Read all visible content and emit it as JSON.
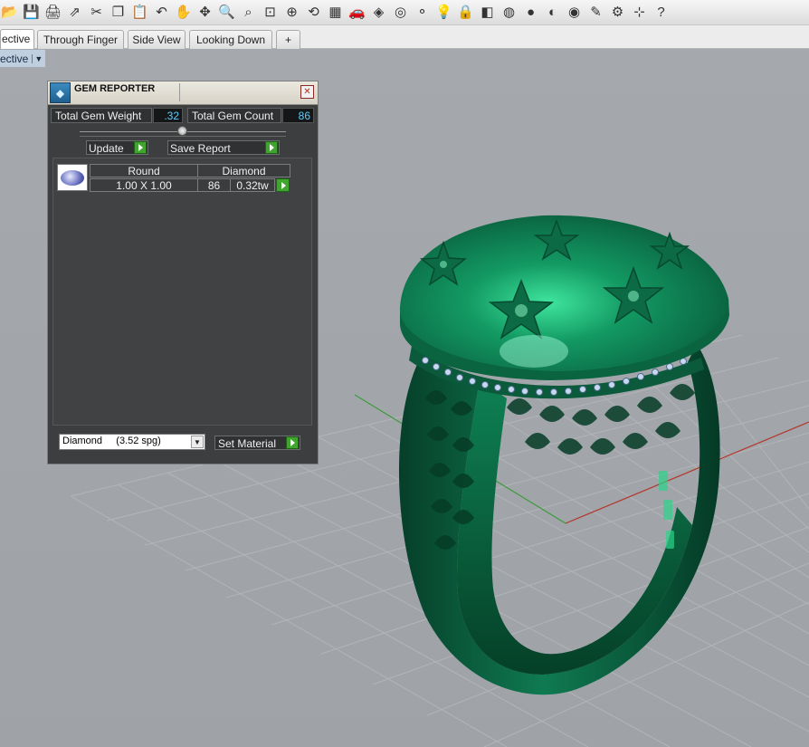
{
  "toolbar": {
    "icons": [
      {
        "name": "open-icon",
        "glyph": "📂"
      },
      {
        "name": "save-icon",
        "glyph": "💾"
      },
      {
        "name": "print-icon",
        "glyph": "🖨"
      },
      {
        "name": "export-icon",
        "glyph": "⇗"
      },
      {
        "name": "cut-icon",
        "glyph": "✂"
      },
      {
        "name": "copy-icon",
        "glyph": "❐"
      },
      {
        "name": "paste-icon",
        "glyph": "📋"
      },
      {
        "name": "undo-icon",
        "glyph": "↶"
      },
      {
        "name": "pan-icon",
        "glyph": "✋"
      },
      {
        "name": "rotate-view-icon",
        "glyph": "✥"
      },
      {
        "name": "zoom-icon",
        "glyph": "🔍"
      },
      {
        "name": "zoom-window-icon",
        "glyph": "⌕"
      },
      {
        "name": "zoom-extents-icon",
        "glyph": "⊡"
      },
      {
        "name": "zoom-selected-icon",
        "glyph": "⊕"
      },
      {
        "name": "zoom-previous-icon",
        "glyph": "⟲"
      },
      {
        "name": "viewport-layout-icon",
        "glyph": "▦"
      },
      {
        "name": "car-icon",
        "glyph": "🚗"
      },
      {
        "name": "grid-snap-icon",
        "glyph": "◈"
      },
      {
        "name": "osnap-icon",
        "glyph": "◎"
      },
      {
        "name": "points-icon",
        "glyph": "⚬"
      },
      {
        "name": "light-bulb-icon",
        "glyph": "💡"
      },
      {
        "name": "lock-icon",
        "glyph": "🔒"
      },
      {
        "name": "layers-icon",
        "glyph": "◧"
      },
      {
        "name": "color-wheel-icon",
        "glyph": "◍"
      },
      {
        "name": "shaded-sphere-icon",
        "glyph": "●"
      },
      {
        "name": "wireframe-sphere-icon",
        "glyph": "◐"
      },
      {
        "name": "render-sphere-icon",
        "glyph": "◉"
      },
      {
        "name": "pencil-icon",
        "glyph": "✎"
      },
      {
        "name": "gear-icon",
        "glyph": "⚙"
      },
      {
        "name": "gumball-icon",
        "glyph": "⊹"
      },
      {
        "name": "help-icon",
        "glyph": "?"
      }
    ]
  },
  "tabs": [
    {
      "label": "ective",
      "active": true
    },
    {
      "label": "Through Finger",
      "active": false
    },
    {
      "label": "Side View",
      "active": false
    },
    {
      "label": "Looking Down",
      "active": false
    },
    {
      "label": "+",
      "active": false
    }
  ],
  "viewport": {
    "title": "ective",
    "menu_arrow": "▼"
  },
  "gem_reporter": {
    "title": "GEM REPORTER",
    "close": "✕",
    "total_weight_label": "Total Gem Weight",
    "total_weight_value": ".32",
    "total_count_label": "Total Gem Count",
    "total_count_value": "86",
    "update_label": "Update",
    "save_report_label": "Save Report",
    "gems": [
      {
        "shape": "Round",
        "material": "Diamond",
        "size": "1.00 X 1.00",
        "count": "86",
        "weight": "0.32tw"
      }
    ],
    "material_select": "Diamond     (3.52 spg)",
    "set_material_label": "Set Material"
  },
  "colors": {
    "ring_green": "#0f7a52",
    "panel_bg": "#3c3e3f",
    "value_text": "#5ccfff",
    "play_green": "#3fa52f"
  }
}
